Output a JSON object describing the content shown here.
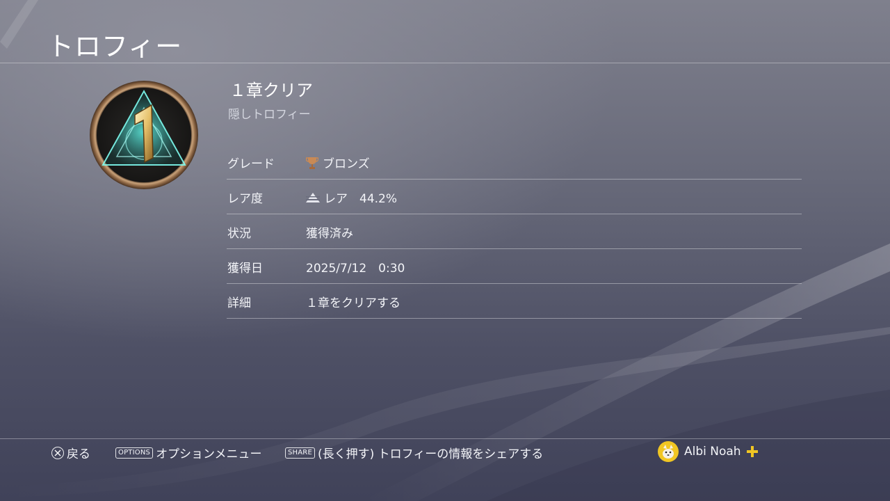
{
  "header": {
    "title": "トロフィー"
  },
  "trophy": {
    "name": "１章クリア",
    "subtitle": "隠しトロフィー",
    "icon": "trophy-badge-chapter-1-icon"
  },
  "details": [
    {
      "label": "グレード",
      "value": "ブロンズ",
      "icon": "bronze-trophy-icon"
    },
    {
      "label": "レア度",
      "value": "レア　44.2%",
      "icon": "rarity-pyramid-icon"
    },
    {
      "label": "状況",
      "value": "獲得済み"
    },
    {
      "label": "獲得日",
      "value": "2025/7/12　0:30"
    },
    {
      "label": "詳細",
      "value": "１章をクリアする"
    }
  ],
  "footer": {
    "back": {
      "button": "cross-button-icon",
      "label": "戻る"
    },
    "options": {
      "chip": "OPTIONS",
      "label": "オプションメニュー"
    },
    "share": {
      "chip": "SHARE",
      "label": "(長く押す) トロフィーの情報をシェアする"
    },
    "user": {
      "name": "Albi Noah",
      "plus": "ps-plus-icon"
    }
  },
  "colors": {
    "accent_gold": "#f1c623",
    "bronze": "#c98a55",
    "badge_teal": "#3fd8cf"
  }
}
